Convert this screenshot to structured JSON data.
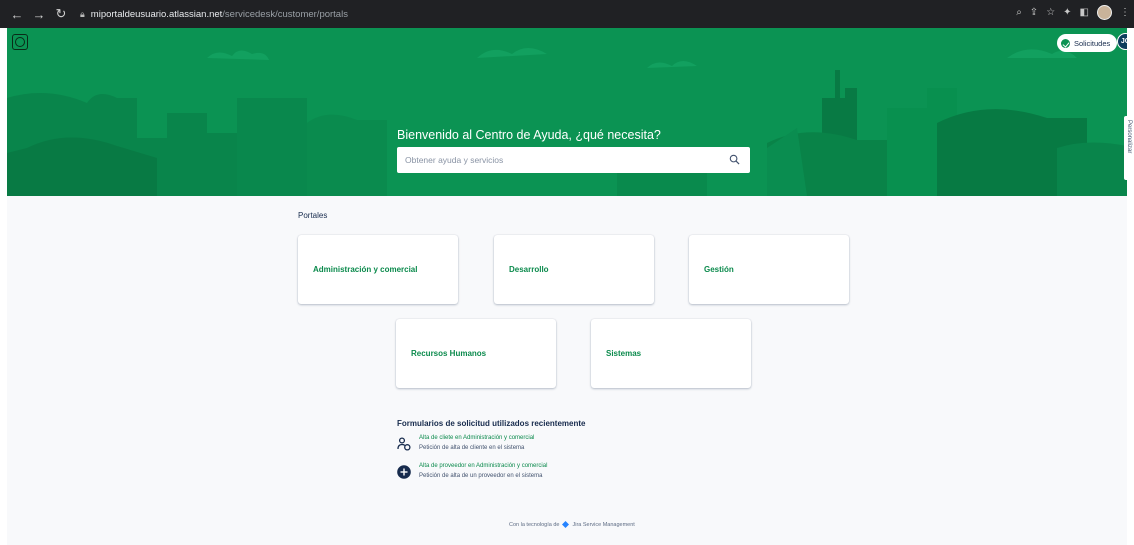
{
  "browser": {
    "url_host": "miportaldeusuario.atlassian.net",
    "url_path": "/servicedesk/customer/portals"
  },
  "header": {
    "requests_label": "Solicitudes",
    "avatar_initials": "JG",
    "side_tab_label": "Personalizar"
  },
  "hero": {
    "welcome": "Bienvenido al Centro de Ayuda, ¿qué necesita?",
    "search_placeholder": "Obtener ayuda y servicios"
  },
  "portals": {
    "title": "Portales",
    "items": [
      {
        "label": "Administración y comercial"
      },
      {
        "label": "Desarrollo"
      },
      {
        "label": "Gestión"
      },
      {
        "label": "Recursos Humanos"
      },
      {
        "label": "Sistemas"
      }
    ]
  },
  "recent": {
    "title": "Formularios de solicitud utilizados recientemente",
    "items": [
      {
        "title": "Alta de cliete en Administración y comercial",
        "description": "Petición de alta de cliente en el sistema",
        "icon": "add-user-icon"
      },
      {
        "title": "Alta de proveedor en Administración y comercial",
        "description": "Petición de alta de un proveedor en el sistema",
        "icon": "plus-circle-icon"
      }
    ]
  },
  "footer": {
    "prefix": "Con la tecnología de",
    "product": "Jira Service Management"
  },
  "colors": {
    "brand": "#0b9353",
    "link": "#0b8a4c"
  }
}
